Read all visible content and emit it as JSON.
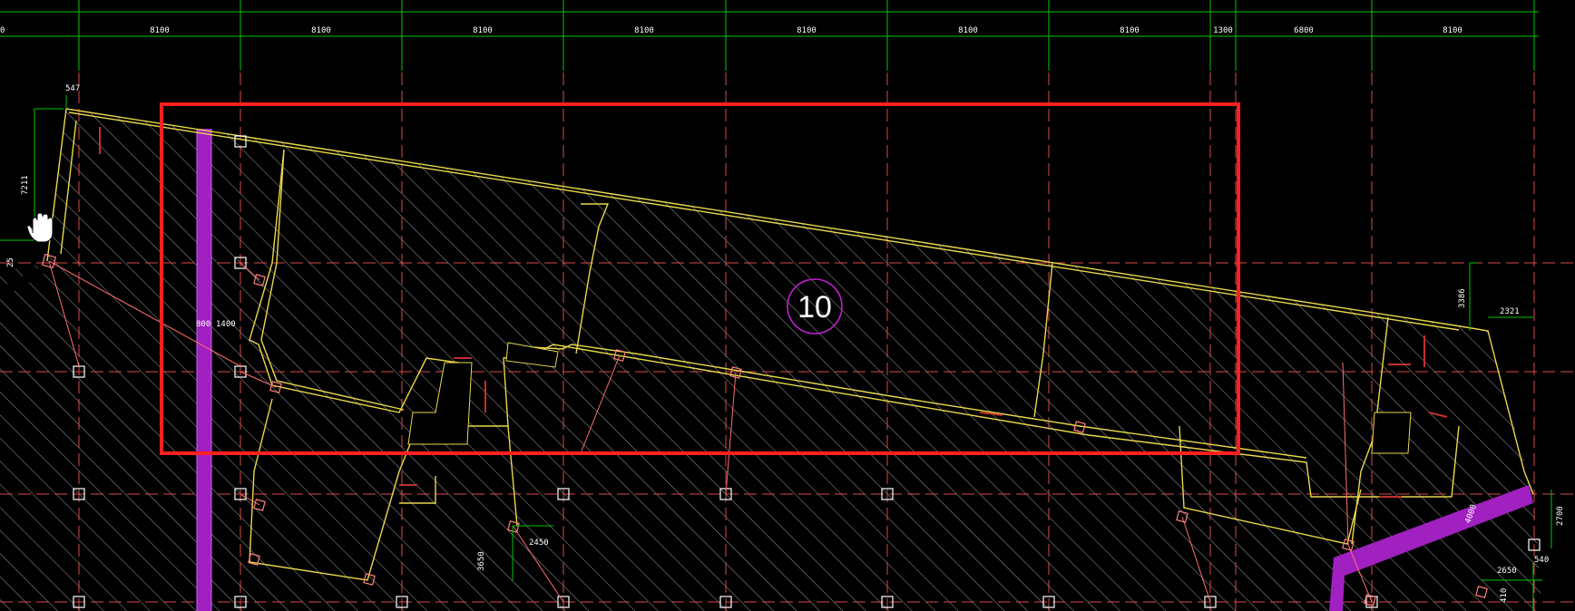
{
  "drawing": {
    "top_dimensions": [
      "0",
      "8100",
      "8100",
      "8100",
      "8100",
      "8100",
      "8100",
      "8100",
      "1300",
      "6800",
      "8100"
    ],
    "zone_number": "10",
    "annotations": {
      "d_547": "547",
      "d_7211": "7211",
      "d_25": "25",
      "d_800": "800",
      "d_1400": "1400",
      "d_3386": "3386",
      "d_2321": "2321",
      "d_2450": "2450",
      "d_3650": "3650",
      "d_2700": "2700",
      "d_2650": "2650",
      "d_540": "540",
      "d_4000": "4000",
      "d_410": "410"
    }
  },
  "colors": {
    "background": "#000000",
    "grid_axis": "#ff6666",
    "dim_line": "#00c800",
    "slab_outline": "#e8d84a",
    "hatch": "#9a9a9a",
    "beam": "#a020c0",
    "selection_box": "#ff2020",
    "zone_circle": "#c020d0",
    "column": "#ffffff",
    "wall_red": "#c03030"
  },
  "cursor": "hand-cursor-icon"
}
